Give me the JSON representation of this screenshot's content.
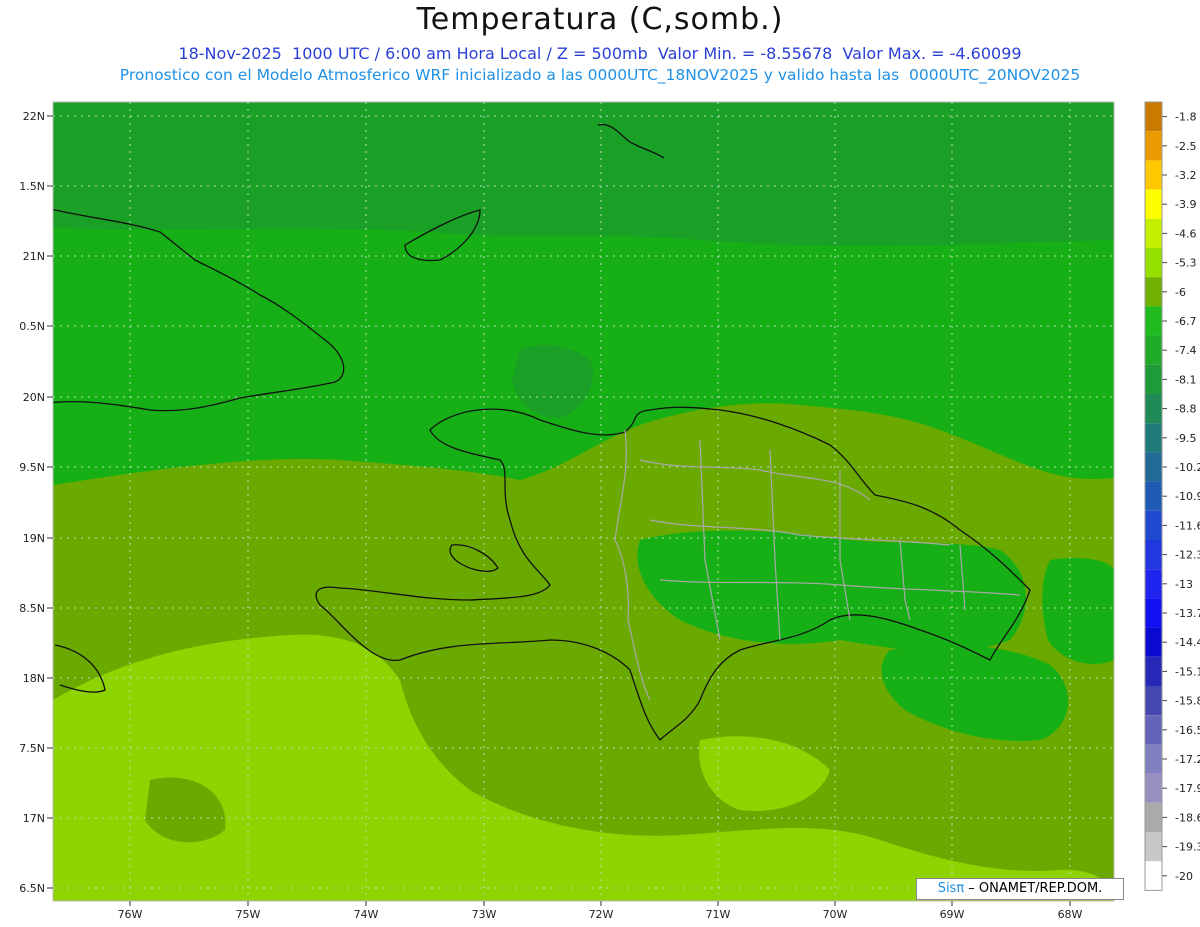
{
  "header": {
    "title": "Temperatura (C,somb.)",
    "line1": "18-Nov-2025  1000 UTC / 6:00 am Hora Local / Z = 500mb  Valor Min. = -8.55678  Valor Max. = -4.60099",
    "line2": "Pronostico con el Modelo Atmosferico WRF inicializado a las 0000UTC_18NOV2025 y valido hasta las  0000UTC_20NOV2025"
  },
  "axes": {
    "lat_labels": [
      "22N",
      "1.5N",
      "21N",
      "0.5N",
      "20N",
      "9.5N",
      "19N",
      "8.5N",
      "18N",
      "7.5N",
      "17N",
      "6.5N"
    ],
    "lon_labels": [
      "76W",
      "75W",
      "74W",
      "73W",
      "72W",
      "71W",
      "70W",
      "69W",
      "68W"
    ]
  },
  "legend": {
    "labels": [
      "-1.8",
      "-2.5",
      "-3.2",
      "-3.9",
      "-4.6",
      "-5.3",
      "-6",
      "-6.7",
      "-7.4",
      "-8.1",
      "-8.8",
      "-9.5",
      "-10.2",
      "-10.9",
      "-11.6",
      "-12.3",
      "-13",
      "-13.7",
      "-14.4",
      "-15.1",
      "-15.8",
      "-16.5",
      "-17.2",
      "-17.9",
      "-18.6",
      "-19.3",
      "-20"
    ],
    "colors": [
      "#c87b00",
      "#e89a00",
      "#ffc800",
      "#ffff00",
      "#c4f000",
      "#96e000",
      "#6fb000",
      "#1fbb1f",
      "#1faa28",
      "#1f9a38",
      "#1f8a55",
      "#1f7a78",
      "#1f6a96",
      "#1f5ab4",
      "#1f4ad0",
      "#1f38e0",
      "#1f24ee",
      "#1010f0",
      "#0a0ad0",
      "#2828b8",
      "#4646b0",
      "#6464b8",
      "#8080c0",
      "#9a90c0",
      "#aaaaaa",
      "#c8c8c8",
      "#ffffff"
    ]
  },
  "map_colors": {
    "green_dark": "#16b016",
    "green_mid": "#1aa026",
    "olive": "#6aaa00",
    "lime": "#8ed400",
    "coast": "#111111",
    "province": "#a8a8a8"
  },
  "credit": {
    "brand": "Sisπ",
    "text": " – ONAMET/REP.DOM."
  }
}
